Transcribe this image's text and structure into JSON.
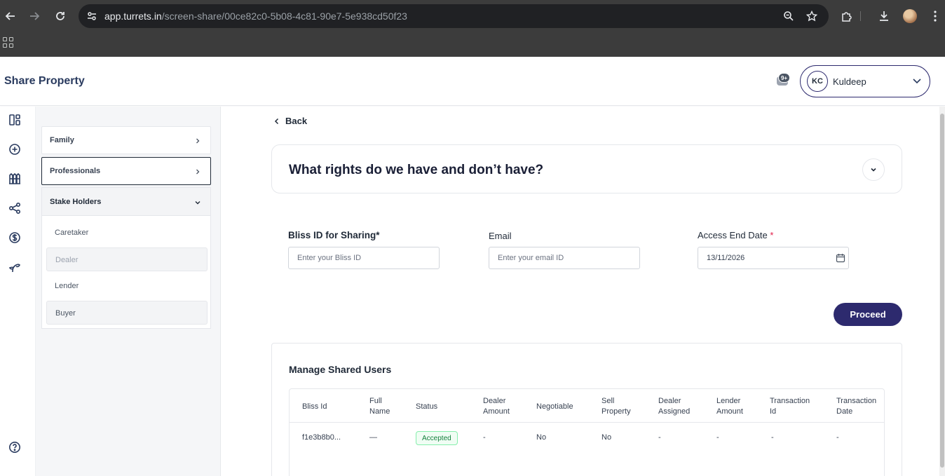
{
  "browser": {
    "url_host": "app.turrets.in",
    "url_path": "/screen-share/00ce82c0-5b08-4c81-90e7-5e938cd50f23"
  },
  "header": {
    "title": "Share Property",
    "notification_badge": "9+",
    "user_initials": "KC",
    "user_name": "Kuldeep"
  },
  "rail_icons": [
    "dashboard-icon",
    "add-circle-icon",
    "properties-icon",
    "share-icon",
    "dollar-icon",
    "plant-icon",
    "help-icon"
  ],
  "categories": {
    "family": "Family",
    "professionals": "Professionals",
    "stake_holders": "Stake Holders",
    "sub_items": [
      "Caretaker",
      "Dealer",
      "Lender",
      "Buyer"
    ]
  },
  "main": {
    "back": "Back",
    "rights_title": "What rights do we have and don’t have?",
    "bliss_label": "Bliss ID for Sharing*",
    "bliss_placeholder": "Enter your Bliss ID",
    "email_label": "Email",
    "email_placeholder": "Enter your email ID",
    "date_label": "Access End Date",
    "date_required": "*",
    "date_value": "13/11/2026",
    "proceed": "Proceed"
  },
  "shared_users": {
    "title": "Manage Shared Users",
    "columns": [
      [
        "Bliss Id"
      ],
      [
        "Full",
        "Name"
      ],
      [
        "Status"
      ],
      [
        "Dealer",
        "Amount"
      ],
      [
        "Negotiable"
      ],
      [
        "Sell",
        "Property"
      ],
      [
        "Dealer",
        "Assigned"
      ],
      [
        "Lender",
        "Amount"
      ],
      [
        "Transaction",
        "Id"
      ],
      [
        "Transaction",
        "Date"
      ]
    ],
    "rows": [
      {
        "bliss_id": "f1e3b8b0...",
        "full_name": "—",
        "status": "Accepted",
        "dealer_amount": "-",
        "negotiable": "No",
        "sell_property": "No",
        "dealer_assigned": "-",
        "lender_amount": "-",
        "transaction_id": "-",
        "transaction_date": "-"
      }
    ]
  },
  "colors": {
    "brand": "#2d2a6e",
    "title_text": "#2a3b5f",
    "status_accepted": "#15803d"
  }
}
